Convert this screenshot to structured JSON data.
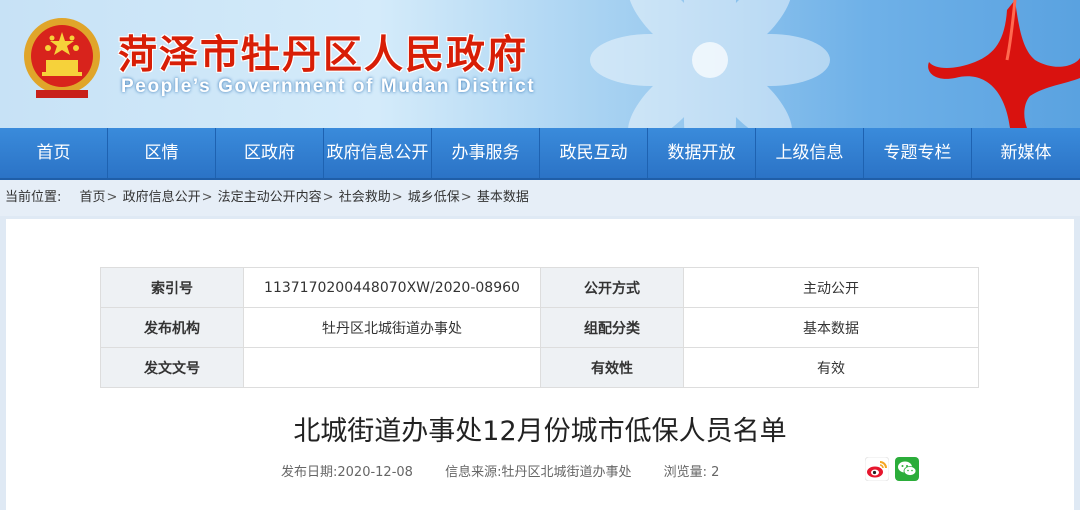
{
  "header": {
    "title": "菏泽市牡丹区人民政府",
    "subtitle": "People’s Government of Mudan District"
  },
  "nav": [
    "首页",
    "区情",
    "区政府",
    "政府信息公开",
    "办事服务",
    "政民互动",
    "数据开放",
    "上级信息",
    "专题专栏",
    "新媒体"
  ],
  "breadcrumb": {
    "label": "当前位置:",
    "items": [
      "首页",
      "政府信息公开",
      "法定主动公开内容",
      "社会救助",
      "城乡低保",
      "基本数据"
    ],
    "separator": ">"
  },
  "meta": {
    "index_label": "索引号",
    "index_value": "11371702004480​70XW/2020-08960",
    "method_label": "公开方式",
    "method_value": "主动公开",
    "issuer_label": "发布机构",
    "issuer_value": "牡丹区北城街道办事处",
    "category_label": "组配分类",
    "category_value": "基本数据",
    "docno_label": "发文文号",
    "docno_value": "",
    "validity_label": "有效性",
    "validity_value": "有效"
  },
  "article": {
    "title": "北城街道办事处12月份城市低保人员名单",
    "date": "发布日期:2020-12-08",
    "source": "信息来源:牡丹区北城街道办事处",
    "views": "浏览量: 2"
  },
  "share": [
    "weibo-icon",
    "wechat-icon"
  ],
  "colors": {
    "title_red": "#d81e06",
    "nav_blue": "#2b73c6",
    "wechat_green": "#2bad3a"
  }
}
